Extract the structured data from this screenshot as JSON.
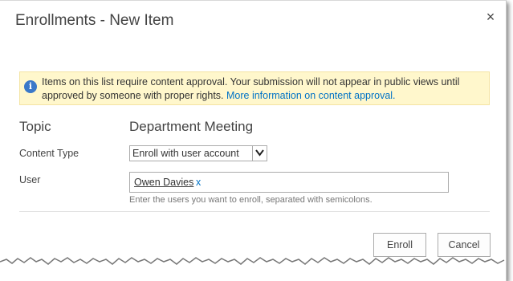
{
  "dialog": {
    "title": "Enrollments - New Item",
    "close_glyph": "×"
  },
  "notice": {
    "icon": "info-icon",
    "message": "Items on this list require content approval. Your submission will not appear in public views until approved by someone with proper rights.",
    "link_text": "More information on content approval."
  },
  "form": {
    "topic_label": "Topic",
    "topic_value": "Department Meeting",
    "content_type_label": "Content Type",
    "content_type_value": "Enroll with user account",
    "user_label": "User",
    "user_value": "Owen Davies",
    "remove_glyph": "x",
    "user_hint": "Enter the users you want to enroll, separated with semicolons."
  },
  "buttons": {
    "enroll": "Enroll",
    "cancel": "Cancel"
  },
  "colors": {
    "notice_bg": "#fff7cc",
    "link": "#0072c6",
    "info_icon": "#3a78c9"
  }
}
